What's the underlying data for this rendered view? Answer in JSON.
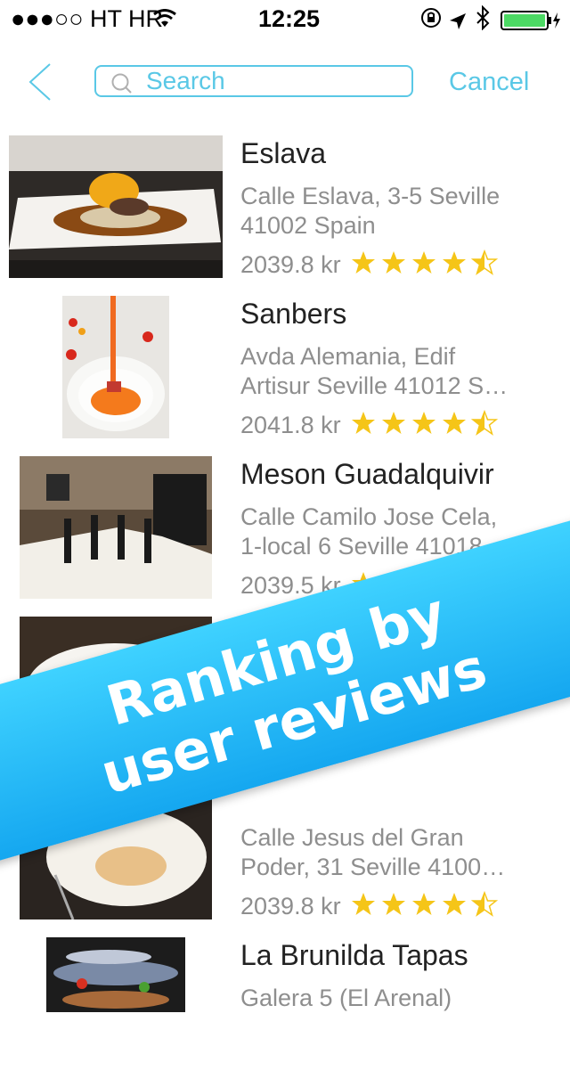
{
  "status_bar": {
    "carrier": "●●●○○ HT HR",
    "time": "12:25"
  },
  "nav": {
    "search_placeholder": "Search",
    "cancel_label": "Cancel"
  },
  "restaurants": [
    {
      "name": "Eslava",
      "address_line1": "Calle Eslava, 3-5 Seville",
      "address_line2": "41002 Spain",
      "price": "2039.8 kr",
      "rating": 4.5
    },
    {
      "name": "Sanbers",
      "address_line1": "Avda Alemania, Edif",
      "address_line2": "Artisur Seville 41012 S…",
      "price": "2041.8 kr",
      "rating": 4.5
    },
    {
      "name": "Meson Guadalquivir",
      "address_line1": "Calle Camilo Jose Cela,",
      "address_line2": "1-local 6 Seville 41018…",
      "price": "2039.5 kr",
      "rating": 4.5
    },
    {
      "name": "",
      "address_line1": "",
      "address_line2": "",
      "price": "",
      "rating": 0
    },
    {
      "name": "",
      "address_line1": "Calle Jesus del Gran",
      "address_line2": "Poder, 31 Seville 4100…",
      "price": "2039.8 kr",
      "rating": 4.5
    },
    {
      "name": "La Brunilda Tapas",
      "address_line1": "Galera 5 (El Arenal)",
      "address_line2": "",
      "price": "",
      "rating": 0
    }
  ],
  "banner": {
    "line1": "Ranking by",
    "line2": "user reviews"
  },
  "colors": {
    "accent": "#5ac8e6",
    "star": "#f5c518",
    "banner": "#1eb4f5"
  }
}
